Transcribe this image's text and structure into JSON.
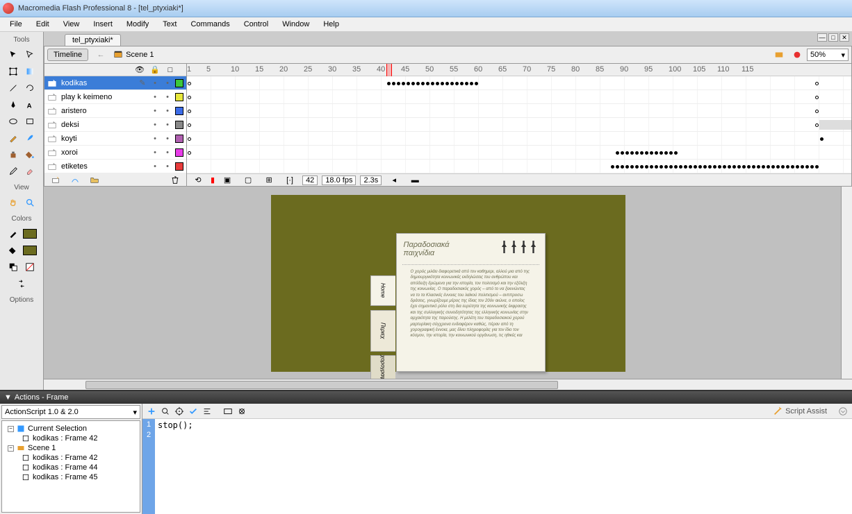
{
  "title": "Macromedia Flash Professional 8 - [tel_ptyxiaki*]",
  "menu": [
    "File",
    "Edit",
    "View",
    "Insert",
    "Modify",
    "Text",
    "Commands",
    "Control",
    "Window",
    "Help"
  ],
  "tools_header": "Tools",
  "view_header": "View",
  "colors_header": "Colors",
  "options_header": "Options",
  "doc_tab": "tel_ptyxiaki*",
  "timeline_btn": "Timeline",
  "scene_label": "Scene 1",
  "zoom": "50%",
  "layers": [
    {
      "name": "kodikas",
      "color": "#3cc83c",
      "selected": true
    },
    {
      "name": "play k keimeno",
      "color": "#e8e83c",
      "selected": false
    },
    {
      "name": "aristero",
      "color": "#3c6ce8",
      "selected": false
    },
    {
      "name": "deksi",
      "color": "#888",
      "selected": false
    },
    {
      "name": "koyti",
      "color": "#b060b0",
      "selected": false
    },
    {
      "name": "xoroi",
      "color": "#e83ce8",
      "selected": false
    },
    {
      "name": "etiketes",
      "color": "#e83c3c",
      "selected": false
    }
  ],
  "ruler_ticks": [
    1,
    5,
    10,
    15,
    20,
    25,
    30,
    35,
    40,
    45,
    50,
    55,
    60,
    65,
    70,
    75,
    80,
    85,
    90,
    95,
    100,
    105,
    110,
    115
  ],
  "frame_status": {
    "current": "42",
    "fps": "18.0 fps",
    "time": "2.3s"
  },
  "page_title": "Παραδοσιακά\nπαιχνίδια",
  "page_tabs": [
    "Home",
    "Περιεχ",
    "χορογραφίες"
  ],
  "page_body": "Ο χορός μιλάει διαφορετικά από τον καθημερι, αλλού μια από της\nδημιουργικότητα κοινωνικές εκδηλώσεις του ανθρώπου και\nαπόδειξη δρώμενα για την ιστορία, τον πολιτισμό και την εξέλιξη\nτης κοινωνίας.\n   Ο παραδοσιακός χορός – από το να ξεκινώντας να το τα\nΚλασικές έννοιες του λαϊκού πολιτισμού – αντιπροσω\nδράσεις, γνωρίζουμε μέρος της ίδιας τον 20όν αιώνα, ο οποίος\nέχει σημαντικό ρόλο στη δια ευρύτητα της κοινωνικής έκφρασης\nκαι της συλλογικής συνειδητότητας της ελληνικής κοινωνίας στην\nαρχαιότητα της παρούσης. Η μελέτη του παραδοσιακού χορού\nμαρτυρίακη σύγχρονα ενδιαφέρον καθώς, πέραν από τη\nχορογραφική έννοια, μας δίνει πληροφορίες για τον ίδιο τον\nκόσμον, την ιστορία, την κοινωνικού οργάνωση, τις ηθικές και",
  "actions_title": "Actions - Frame",
  "as_version": "ActionScript 1.0 & 2.0",
  "tree": {
    "cur_sel": "Current Selection",
    "cur_item": "kodikas : Frame 42",
    "scene": "Scene 1",
    "items": [
      "kodikas : Frame 42",
      "kodikas : Frame 44",
      "kodikas : Frame 45"
    ]
  },
  "script_assist": "Script Assist",
  "code_line1": "stop();",
  "gutter": [
    "1",
    "2"
  ]
}
